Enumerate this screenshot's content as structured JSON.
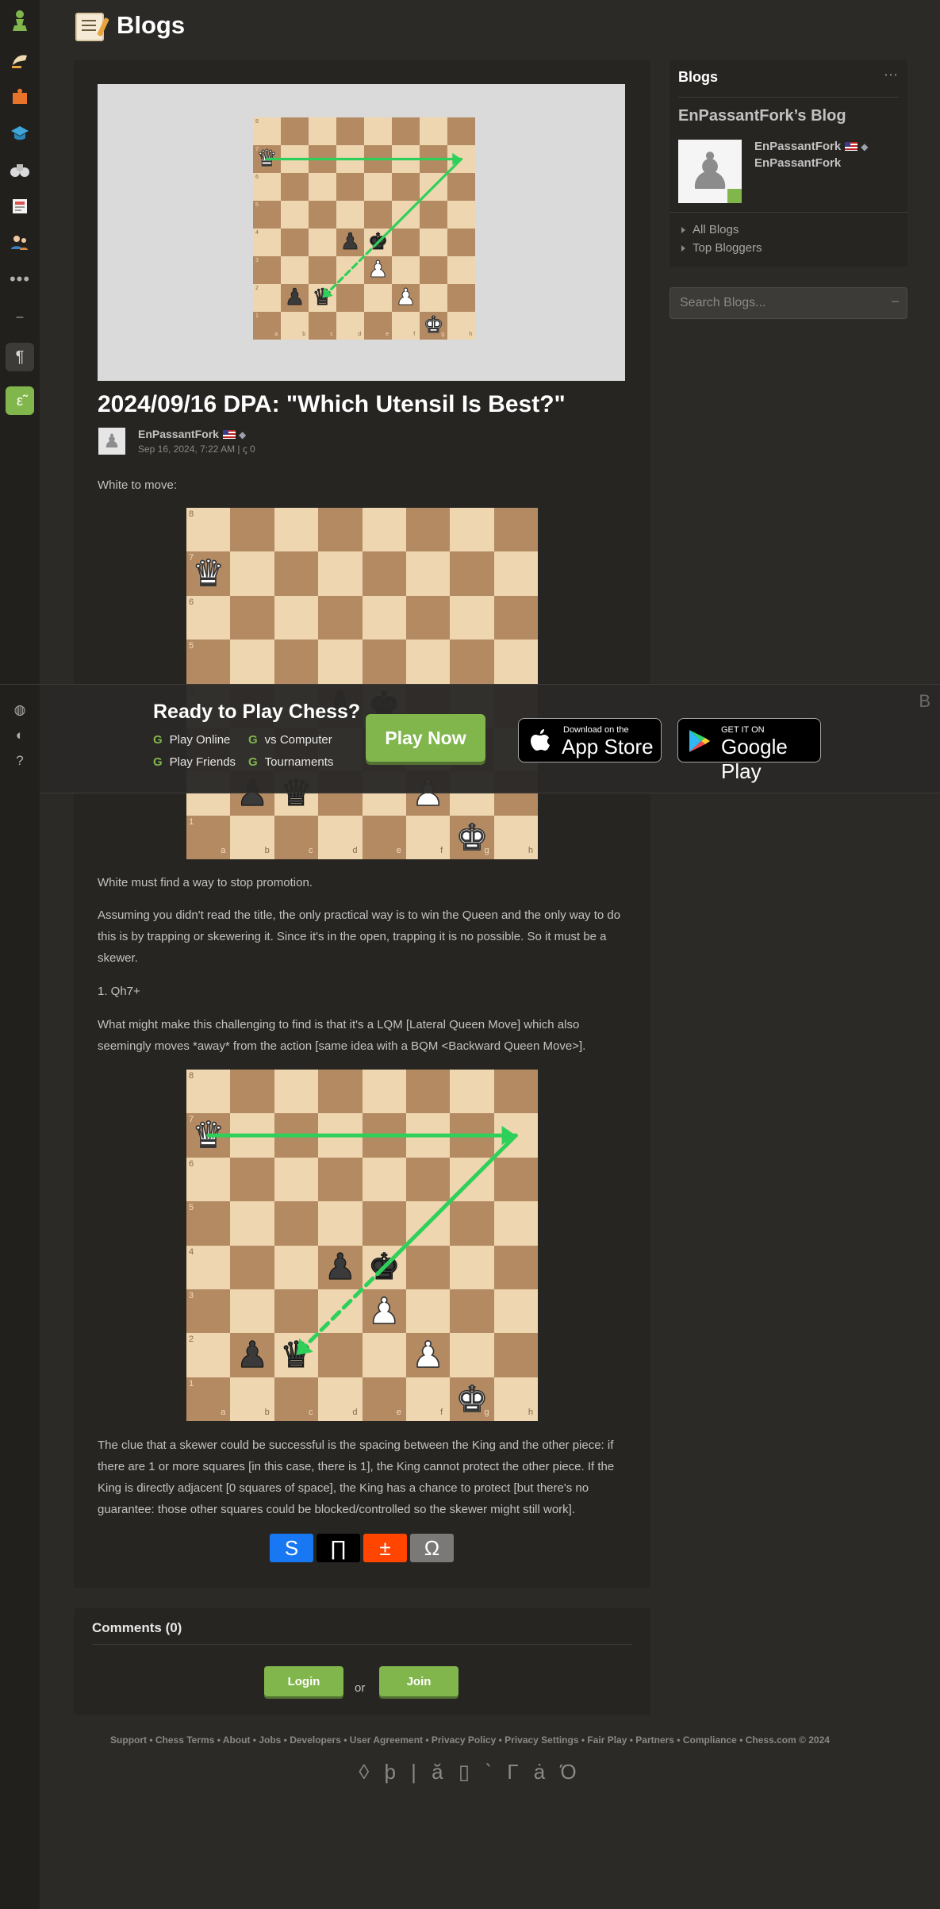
{
  "header": {
    "title": "Blogs"
  },
  "post": {
    "title": "2024/09/16 DPA: \"Which Utensil Is Best?\"",
    "author": "EnPassantFork",
    "date": "Sep 16, 2024, 7:22 AM |",
    "comment_icon": "ꞔ",
    "comment_count": "0",
    "p1": "White to move:",
    "p2": "White must find a way to stop promotion.",
    "p3": "Assuming you didn't read the title, the only practical way is to win the Queen and the only way to do this is by trapping or skewering it.  Since it's in the open, trapping it is no possible.  So it must be a skewer.",
    "p4": "1. Qh7+",
    "p5": "What might make this challenging to find is that it's a LQM [Lateral Queen Move] which also seemingly moves *away* from the action [same idea with a BQM <Backward Queen Move>].",
    "p6": "The clue that a skewer could be successful is the spacing between the King and the other piece: if there are 1 or more squares [in this case, there is 1], the King cannot protect the other piece.  If the King is directly adjacent [0 squares of space], the King has a chance to protect [but there's no guarantee:  those other squares could be blocked/controlled so the skewer might still work]."
  },
  "share": {
    "s1": "S",
    "s2": "∏",
    "s3": "±",
    "s4": "Ω"
  },
  "comments": {
    "title": "Comments (0)",
    "login": "Login",
    "or": "or",
    "join": "Join"
  },
  "right": {
    "head": "Blogs",
    "more": "⋯",
    "blog_title": "EnPassantFork’s Blog",
    "name": "EnPassantFork",
    "name2": "EnPassantFork",
    "links": [
      "All Blogs",
      "Top Bloggers"
    ]
  },
  "search": {
    "placeholder": "Search Blogs...",
    "btn": "–"
  },
  "banner": {
    "title": "Ready to Play Chess?",
    "items": [
      "Play Online",
      "vs Computer",
      "Play Friends",
      "Tournaments"
    ],
    "g": "G",
    "play": "Play Now",
    "appstore_small": "Download on the",
    "appstore_big": "App Store",
    "gplay_small": "GET IT ON",
    "gplay_big": "Google Play",
    "close": "B"
  },
  "sidebar": {
    "dots": "•••",
    "dash": "–",
    "para": "¶",
    "green": "ε̃"
  },
  "footer": {
    "links": "Support • Chess Terms • About • Jobs • Developers • User Agreement • Privacy Policy • Privacy Settings • Fair Play • Partners • Compliance • Chess.com © 2024",
    "icons": "◊ þ | ă ▯ ` Γ ȧ Ό"
  },
  "boards": {
    "ranks": [
      "8",
      "7",
      "6",
      "5",
      "4",
      "3",
      "2",
      "1"
    ],
    "files": [
      "a",
      "b",
      "c",
      "d",
      "e",
      "f",
      "g",
      "h"
    ],
    "diagram": {
      "pieces": [
        {
          "sq": "a7",
          "glyph": "♛",
          "color": "white"
        },
        {
          "sq": "d4",
          "glyph": "♟",
          "color": "black"
        },
        {
          "sq": "e4",
          "glyph": "♚",
          "color": "black"
        },
        {
          "sq": "e3",
          "glyph": "♟",
          "color": "white"
        },
        {
          "sq": "b2",
          "glyph": "♟",
          "color": "black"
        },
        {
          "sq": "c2",
          "glyph": "♛",
          "color": "black"
        },
        {
          "sq": "f2",
          "glyph": "♟",
          "color": "white"
        },
        {
          "sq": "g1",
          "glyph": "♚",
          "color": "white"
        }
      ],
      "arrows": [
        [
          "a7",
          "h7"
        ],
        [
          "h7",
          "e4"
        ],
        [
          "e4",
          "c2"
        ]
      ]
    }
  },
  "colors": {
    "accent": "#81b64c",
    "light_square": "#eed6b0",
    "dark_square": "#b38a62",
    "arrow": "#2fd05a"
  }
}
